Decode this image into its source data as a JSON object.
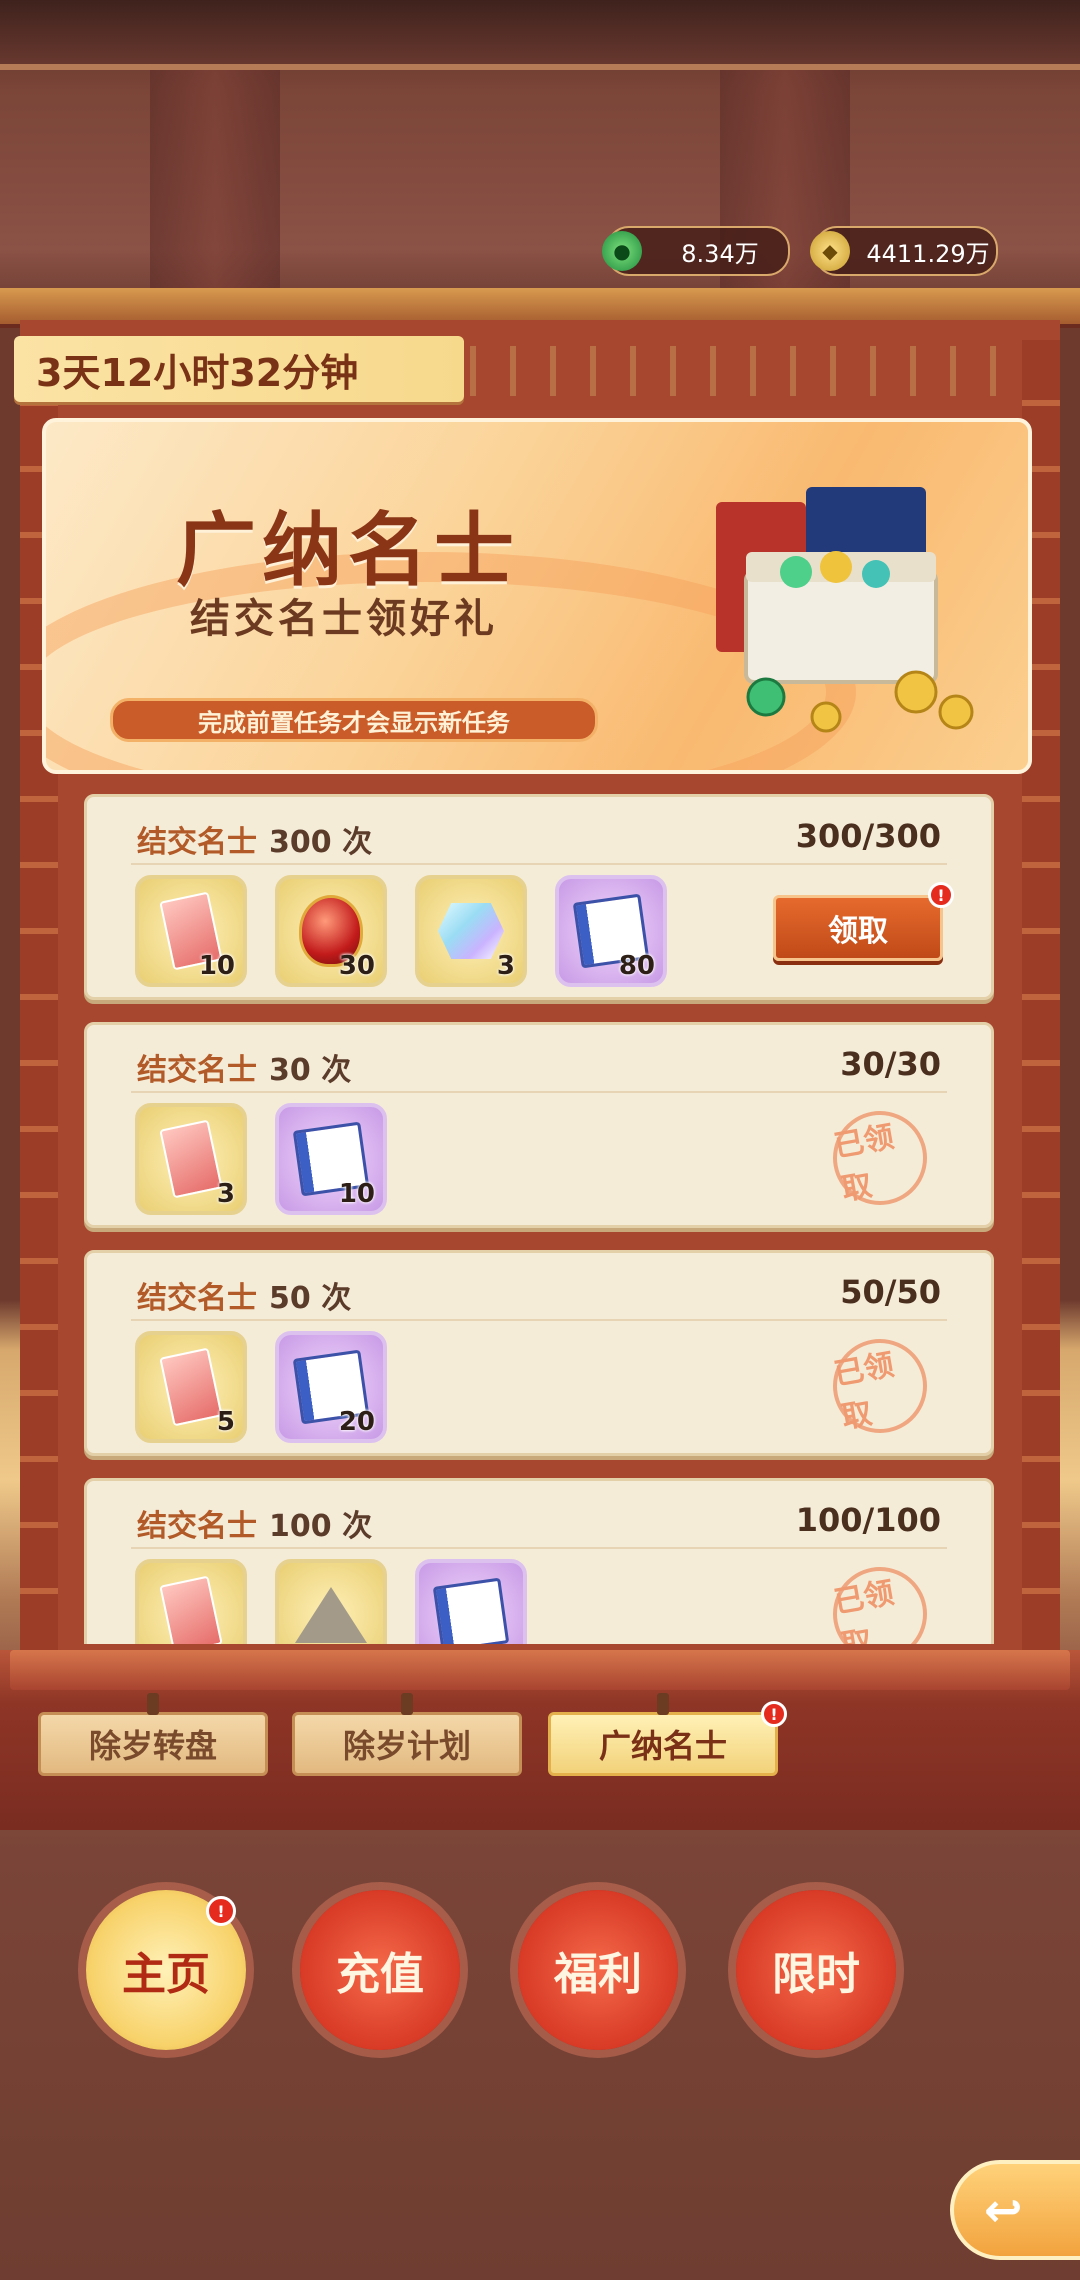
{
  "currency": {
    "jade": {
      "value": "8.34万",
      "icon": "jade-coin-icon"
    },
    "gold": {
      "value": "4411.29万",
      "icon": "gold-coin-icon"
    }
  },
  "timer": "3天12小时32分钟",
  "banner": {
    "title": "广纳名士",
    "subtitle": "结交名士领好礼",
    "notice": "完成前置任务才会显示新任务"
  },
  "tasks": [
    {
      "name": "结交名士",
      "count": "300 次",
      "progress": "300/300",
      "rewards": [
        {
          "icon": "red-card-icon",
          "qty": "10"
        },
        {
          "icon": "red-gem-icon",
          "qty": "30"
        },
        {
          "icon": "crystal-icon",
          "qty": "3"
        },
        {
          "icon": "book-icon",
          "qty": "80"
        }
      ],
      "action": "领取",
      "badge": "!"
    },
    {
      "name": "结交名士",
      "count": "30 次",
      "progress": "30/30",
      "rewards": [
        {
          "icon": "red-card-icon",
          "qty": "3"
        },
        {
          "icon": "book-icon",
          "qty": "10"
        }
      ],
      "status": "已领取"
    },
    {
      "name": "结交名士",
      "count": "50 次",
      "progress": "50/50",
      "rewards": [
        {
          "icon": "red-card-icon",
          "qty": "5"
        },
        {
          "icon": "book-icon",
          "qty": "20"
        }
      ],
      "status": "已领取"
    },
    {
      "name": "结交名士",
      "count": "100 次",
      "progress": "100/100",
      "rewards": [
        {
          "icon": "red-card-icon",
          "qty": ""
        },
        {
          "icon": "tent-icon",
          "qty": ""
        },
        {
          "icon": "book-icon",
          "qty": ""
        }
      ],
      "status": "已领取"
    }
  ],
  "tabs": [
    {
      "label": "除岁转盘"
    },
    {
      "label": "除岁计划"
    },
    {
      "label": "广纳名士",
      "active": true,
      "badge": "!"
    }
  ],
  "nav": [
    {
      "label": "主页",
      "active": true,
      "badge": "!"
    },
    {
      "label": "充值"
    },
    {
      "label": "福利"
    },
    {
      "label": "限时"
    }
  ],
  "back": {
    "icon": "back-arrow-icon",
    "glyph": "↩"
  },
  "colors": {
    "accent": "#c04a18",
    "frame": "#a7472f",
    "card_bg": "#f5ecd8"
  }
}
